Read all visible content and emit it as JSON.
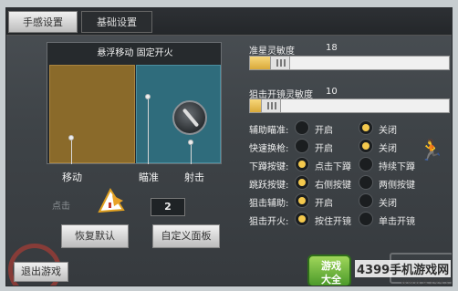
{
  "tabs": [
    {
      "label": "手感设置",
      "active": true
    },
    {
      "label": "基础设置",
      "active": false
    }
  ],
  "preview": {
    "title": "悬浮移动 固定开火",
    "labels": {
      "move": "移动",
      "aim": "瞄准",
      "fire": "射击"
    }
  },
  "layout_number": "2",
  "ghost_text": "点击",
  "buttons": {
    "reset": "恢复默认",
    "custom_panel": "自定义面板",
    "exit": "退出游戏"
  },
  "sliders": [
    {
      "label": "准星灵敏度",
      "value": "18",
      "level": 0.18
    },
    {
      "label": "狙击开镜灵敏度",
      "value": "10",
      "level": 0.1
    }
  ],
  "options": [
    {
      "label": "辅助瞄准:",
      "a": "开启",
      "b": "关闭",
      "selected": "b"
    },
    {
      "label": "快速换枪:",
      "a": "开启",
      "b": "关闭",
      "selected": "b"
    },
    {
      "label": "下蹲按键:",
      "a": "点击下蹲",
      "b": "持续下蹲",
      "selected": "a"
    },
    {
      "label": "跳跃按键:",
      "a": "右侧按键",
      "b": "两侧按键",
      "selected": "a"
    },
    {
      "label": "狙击辅助:",
      "a": "开启",
      "b": "关闭",
      "selected": "a"
    },
    {
      "label": "狙击开火:",
      "a": "按住开镜",
      "b": "单击开镜",
      "selected": "a"
    }
  ],
  "watermark": {
    "logo_top": "游戏",
    "logo_bottom": "大全",
    "site": "4399手机游戏网",
    "url": "www.4399.cn"
  },
  "colors": {
    "accent": "#f4c94d",
    "move_zone": "#8a6a2a",
    "aim_zone": "#2f6c7c"
  }
}
